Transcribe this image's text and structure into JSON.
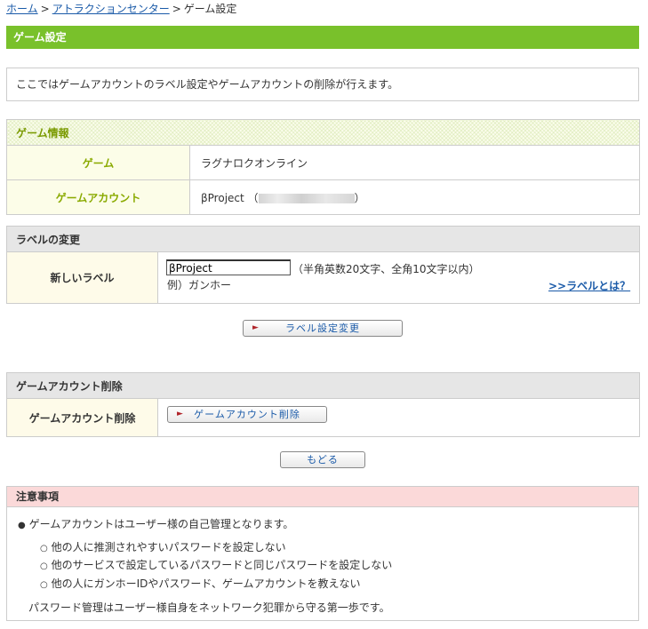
{
  "breadcrumb": {
    "home": "ホーム",
    "sep1": ">",
    "attraction": "アトラクションセンター",
    "sep2": ">",
    "current": "ゲーム設定"
  },
  "page_title": "ゲーム設定",
  "intro_text": "ここではゲームアカウントのラベル設定やゲームアカウントの削除が行えます。",
  "game_info": {
    "heading": "ゲーム情報",
    "game_label": "ゲーム",
    "game_value": "ラグナロクオンライン",
    "account_label": "ゲームアカウント",
    "account_name": "βProject",
    "paren_open": "（",
    "paren_close": "）"
  },
  "label_change": {
    "heading": "ラベルの変更",
    "field_label": "新しいラベル",
    "input_value": "βProject",
    "hint": "（半角英数20文字、全角10文字以内）",
    "example": "例）ガンホー",
    "help_link": ">>ラベルとは？",
    "submit_button": "ラベル設定変更"
  },
  "account_delete": {
    "heading": "ゲームアカウント削除",
    "field_label": "ゲームアカウント削除",
    "button": "ゲームアカウント削除"
  },
  "back_button": "もどる",
  "notice": {
    "heading": "注意事項",
    "main_item": "ゲームアカウントはユーザー様の自己管理となります。",
    "sub_items": [
      "他の人に推測されやすいパスワードを設定しない",
      "他のサービスで設定しているパスワードと同じパスワードを設定しない",
      "他の人にガンホーIDやパスワード、ゲームアカウントを教えない"
    ],
    "footer": "パスワード管理はユーザー様自身をネットワーク犯罪から守る第一歩です。"
  },
  "icons": {
    "button_arrow": "arrow-right-icon",
    "bullet_filled": "bullet-disc",
    "bullet_hollow": "bullet-circle"
  },
  "colors": {
    "title_green": "#79c12b",
    "link_blue": "#1a5aa8",
    "label_olive": "#8aaa00",
    "notice_pink": "#fbd9d9",
    "arrow_red": "#b0242a"
  }
}
